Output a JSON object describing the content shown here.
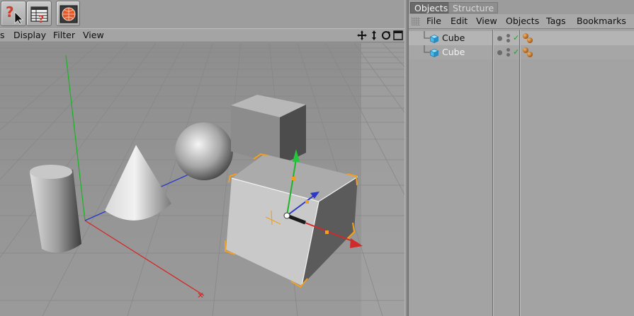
{
  "viewport_menu": {
    "items": [
      "s",
      "Display",
      "Filter",
      "View"
    ]
  },
  "objects_panel": {
    "tabs": [
      "Objects",
      "Structure"
    ],
    "menu": [
      "File",
      "Edit",
      "View",
      "Objects",
      "Tags",
      "Bookmarks"
    ],
    "objects": [
      {
        "name": "Cube",
        "selected": true
      },
      {
        "name": "Cube",
        "selected": false
      }
    ]
  },
  "colors": {
    "x_axis": "#d22a2a",
    "y_axis": "#1fb32a",
    "z_axis": "#2a39c8",
    "selection": "#f0a020",
    "panel_bg": "#a5a5a5"
  }
}
